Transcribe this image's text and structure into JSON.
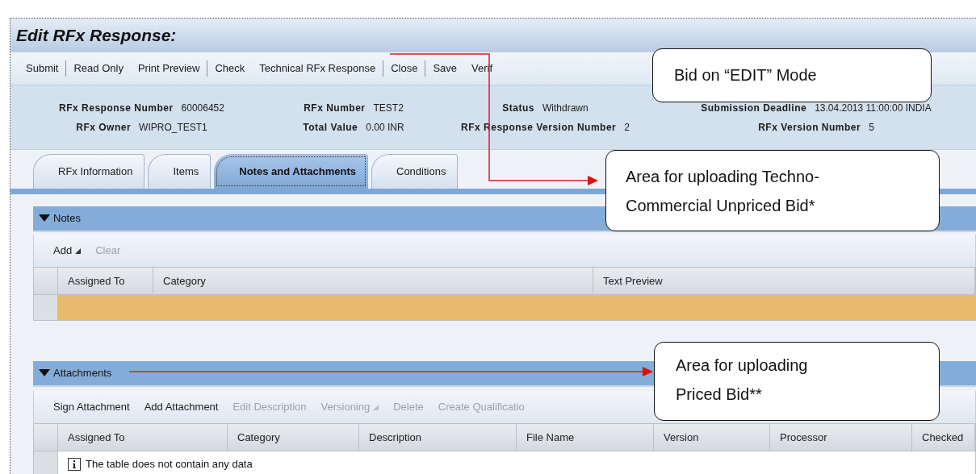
{
  "title": "Edit RFx Response:",
  "toolbar": [
    {
      "label": "Submit",
      "separator_after": true
    },
    {
      "label": "Read Only",
      "separator_after": false
    },
    {
      "label": "Print Preview",
      "separator_after": true
    },
    {
      "label": "Check",
      "separator_after": false
    },
    {
      "label": "Technical RFx Response",
      "separator_after": true
    },
    {
      "label": "Close",
      "separator_after": true
    },
    {
      "label": "Save",
      "separator_after": false
    },
    {
      "label": "Verif",
      "separator_after": false
    }
  ],
  "header_rows": [
    [
      {
        "label": "RFx Response Number",
        "value": "60006452"
      },
      {
        "label": "RFx Number",
        "value": "TEST2"
      },
      {
        "label": "Status",
        "value": "Withdrawn"
      },
      {
        "label": "Submission Deadline",
        "value": "13.04.2013 11:00:00 INDIA"
      }
    ],
    [
      {
        "label": "RFx Owner",
        "value": "WIPRO_TEST1"
      },
      {
        "label": "Total Value",
        "value": "0.00 INR"
      },
      {
        "label": "RFx Response Version Number",
        "value": "2"
      },
      {
        "label": "RFx Version Number",
        "value": "5"
      }
    ]
  ],
  "tabs": [
    {
      "label": "RFx Information",
      "selected": false
    },
    {
      "label": "Items",
      "selected": false
    },
    {
      "label": "Notes and Attachments",
      "selected": true
    },
    {
      "label": "Conditions",
      "selected": false
    }
  ],
  "notes": {
    "title": "Notes",
    "expanded": true,
    "toolbar": [
      {
        "label": "Add",
        "disabled": false,
        "menu": true
      },
      {
        "label": "Clear",
        "disabled": true,
        "menu": false
      }
    ],
    "columns": [
      "Assigned To",
      "Category",
      "Text Preview"
    ],
    "rows": [
      {
        "selected": true
      }
    ]
  },
  "attachments": {
    "title": "Attachments",
    "expanded": true,
    "toolbar": [
      {
        "label": "Sign Attachment",
        "disabled": false,
        "menu": false
      },
      {
        "label": "Add Attachment",
        "disabled": false,
        "menu": false
      },
      {
        "label": "Edit Description",
        "disabled": true,
        "menu": false
      },
      {
        "label": "Versioning",
        "disabled": true,
        "menu": true
      },
      {
        "label": "Delete",
        "disabled": true,
        "menu": false
      },
      {
        "label": "Create Qualificatio",
        "disabled": true,
        "menu": false
      }
    ],
    "columns": [
      "Assigned To",
      "Category",
      "Description",
      "File Name",
      "Version",
      "Processor",
      "Checked"
    ],
    "empty_message": "The table does not contain any data"
  },
  "callouts": [
    {
      "text": "Bid on “EDIT” Mode"
    },
    {
      "text": "Area for uploading Techno-\nCommercial Unpriced Bid*"
    },
    {
      "text": "Area for uploading\nPriced Bid**"
    }
  ]
}
